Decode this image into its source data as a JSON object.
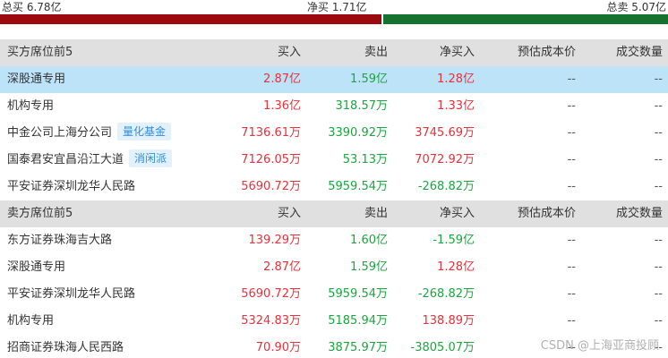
{
  "summary": {
    "total_buy": "总买 6.78亿",
    "net_buy": "净买 1.71亿",
    "total_sell": "总卖 5.07亿"
  },
  "colors": {
    "up": "#e8313b",
    "down": "#1ba63f",
    "bar_buy": "#9c0a0f",
    "bar_sell": "#15722f"
  },
  "buy_section": {
    "header": [
      "买方席位前5",
      "买入",
      "卖出",
      "净买入",
      "预估成本价",
      "成交数量"
    ],
    "rows": [
      {
        "name": "深股通专用",
        "tag": "",
        "buy": "2.87亿",
        "sell": "1.59亿",
        "net": "1.28亿",
        "cost": "--",
        "volume": "--"
      },
      {
        "name": "机构专用",
        "tag": "",
        "buy": "1.36亿",
        "sell": "318.57万",
        "net": "1.33亿",
        "cost": "--",
        "volume": "--"
      },
      {
        "name": "中金公司上海分公司",
        "tag": "量化基金",
        "buy": "7136.61万",
        "sell": "3390.92万",
        "net": "3745.69万",
        "cost": "--",
        "volume": "--"
      },
      {
        "name": "国泰君安宜昌沿江大道",
        "tag": "消闲派",
        "buy": "7126.05万",
        "sell": "53.13万",
        "net": "7072.92万",
        "cost": "--",
        "volume": "--"
      },
      {
        "name": "平安证券深圳龙华人民路",
        "tag": "",
        "buy": "5690.72万",
        "sell": "5959.54万",
        "net": "-268.82万",
        "cost": "--",
        "volume": "--"
      }
    ]
  },
  "sell_section": {
    "header": [
      "卖方席位前5",
      "买入",
      "卖出",
      "净买入",
      "预估成本价",
      "成交数量"
    ],
    "rows": [
      {
        "name": "东方证券珠海吉大路",
        "tag": "",
        "buy": "139.29万",
        "sell": "1.60亿",
        "net": "-1.59亿",
        "cost": "--",
        "volume": "--"
      },
      {
        "name": "深股通专用",
        "tag": "",
        "buy": "2.87亿",
        "sell": "1.59亿",
        "net": "1.28亿",
        "cost": "--",
        "volume": "--"
      },
      {
        "name": "平安证券深圳龙华人民路",
        "tag": "",
        "buy": "5690.72万",
        "sell": "5959.54万",
        "net": "-268.82万",
        "cost": "--",
        "volume": "--"
      },
      {
        "name": "机构专用",
        "tag": "",
        "buy": "5324.83万",
        "sell": "5185.94万",
        "net": "138.89万",
        "cost": "--",
        "volume": "--"
      },
      {
        "name": "招商证券珠海人民西路",
        "tag": "",
        "buy": "70.90万",
        "sell": "3875.97万",
        "net": "-3805.07万",
        "cost": "--",
        "volume": "--"
      }
    ]
  },
  "watermark": "CSDN @上海亚商投顾"
}
